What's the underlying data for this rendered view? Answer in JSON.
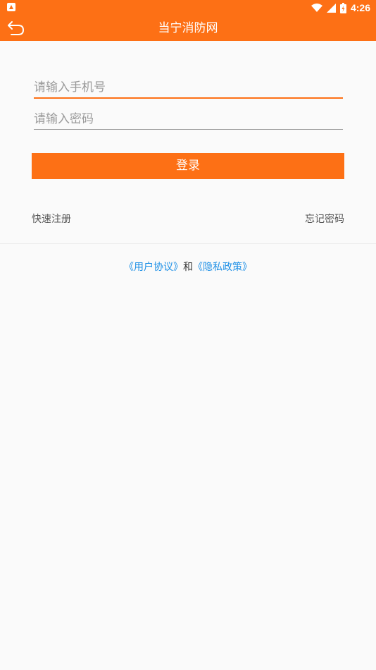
{
  "status_bar": {
    "time": "4:26",
    "icons": [
      "notification-icon",
      "wifi-icon",
      "signal-icon",
      "battery-icon"
    ]
  },
  "app_bar": {
    "title": "当宁消防网",
    "back_icon": "back-arrow-icon"
  },
  "form": {
    "phone_placeholder": "请输入手机号",
    "phone_value": "",
    "password_placeholder": "请输入密码",
    "password_value": "",
    "login_label": "登录"
  },
  "links": {
    "register": "快速注册",
    "forgot": "忘记密码"
  },
  "agreement": {
    "user_agreement": "《用户协议》",
    "conjunction": "和",
    "privacy_policy": "《隐私政策》"
  },
  "colors": {
    "accent": "#fd7015",
    "link_blue": "#1e90e6"
  }
}
